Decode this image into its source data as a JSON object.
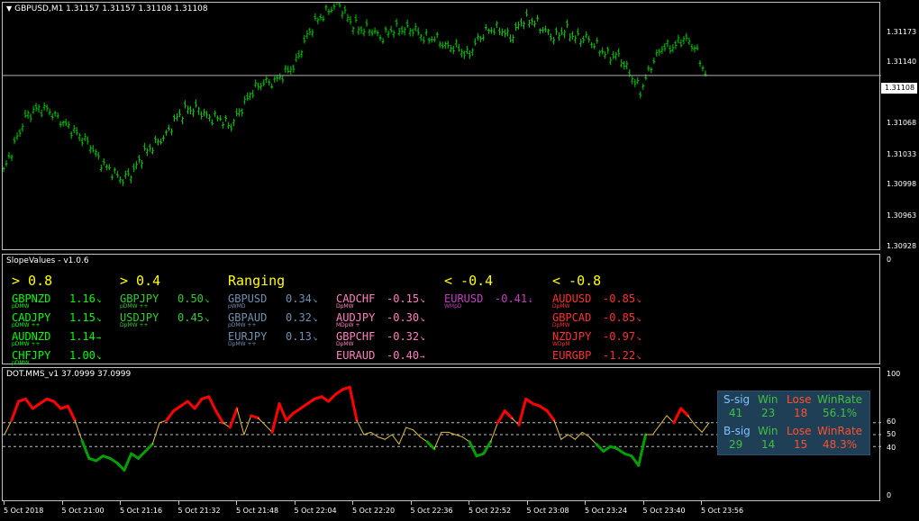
{
  "main_chart": {
    "title": "GBPUSD,M1  1.31157 1.31157 1.31108 1.31108",
    "current_price": "1.31108",
    "y_labels": [
      "1.31173",
      "1.31140",
      "1.31068",
      "1.31033",
      "1.30998",
      "1.30963",
      "1.30928"
    ],
    "bar_color": "#00c800",
    "chart_data": {
      "type": "candlestick",
      "ylim": [
        1.3091,
        1.3119
      ],
      "close_series": [
        1.31,
        1.3103,
        1.3106,
        1.3107,
        1.3107,
        1.3106,
        1.3105,
        1.3104,
        1.3103,
        1.3101,
        1.31,
        1.3099,
        1.31,
        1.3102,
        1.3103,
        1.3104,
        1.3106,
        1.3107,
        1.3107,
        1.3106,
        1.3106,
        1.3105,
        1.3107,
        1.3109,
        1.311,
        1.311,
        1.3111,
        1.3112,
        1.3115,
        1.3117,
        1.3118,
        1.3119,
        1.3117,
        1.3116,
        1.3116,
        1.3115,
        1.3116,
        1.3116,
        1.3116,
        1.3115,
        1.3115,
        1.3114,
        1.3114,
        1.3113,
        1.3115,
        1.3116,
        1.3116,
        1.3115,
        1.3117,
        1.3117,
        1.3116,
        1.3115,
        1.3116,
        1.3115,
        1.3115,
        1.3114,
        1.3113,
        1.3113,
        1.3111,
        1.3109,
        1.3112,
        1.3114,
        1.3114,
        1.3115,
        1.3114,
        1.3111
      ]
    }
  },
  "slope_panel": {
    "title": "SlopeValues - v1.0.6",
    "scale_top": "0",
    "columns": [
      {
        "header": "> 0.8",
        "color": "#ffff00",
        "items": [
          {
            "name": "GBPNZD",
            "value": "1.16",
            "arrow": "↘",
            "sub": "pDMW",
            "color": "#00ff00"
          },
          {
            "name": "CADJPY",
            "value": "1.15",
            "arrow": "↘",
            "sub": "pDMW ++",
            "color": "#00ff00"
          },
          {
            "name": "AUDNZD",
            "value": "1.14",
            "arrow": "→",
            "sub": "pDMW ++",
            "color": "#00ff00"
          },
          {
            "name": "CHFJPY",
            "value": "1.00",
            "arrow": "↘",
            "sub": "pDMW",
            "color": "#00ff00"
          }
        ]
      },
      {
        "header": "> 0.4",
        "color": "#ffff00",
        "items": [
          {
            "name": "GBPJPY",
            "value": "0.50",
            "arrow": "↘",
            "sub": "pDMW ++",
            "color": "#32cd32"
          },
          {
            "name": "USDJPY",
            "value": "0.45",
            "arrow": "↘",
            "sub": "DpMW ++",
            "color": "#32cd32"
          }
        ]
      },
      {
        "header": "Ranging",
        "color": "#ffff00",
        "items": [
          {
            "name": "GBPUSD",
            "value": "0.34",
            "arrow": "↘",
            "sub": "pWMD",
            "color": "#7090b0"
          },
          {
            "name": "GBPAUD",
            "value": "0.32",
            "arrow": "↘",
            "sub": "pDMW ++",
            "color": "#7090b0"
          },
          {
            "name": "EURJPY",
            "value": "0.13",
            "arrow": "↘",
            "sub": "DpMW ++",
            "color": "#7090b0"
          }
        ]
      },
      {
        "header": "",
        "color": "#ffff00",
        "items": [
          {
            "name": "CADCHF",
            "value": "-0.15",
            "arrow": "↘",
            "sub": "DpMW",
            "color": "#ff80c0"
          },
          {
            "name": "AUDJPY",
            "value": "-0.30",
            "arrow": "↘",
            "sub": "MDpW +",
            "color": "#ff80c0"
          },
          {
            "name": "GBPCHF",
            "value": "-0.32",
            "arrow": "↘",
            "sub": "DpMW",
            "color": "#ff80c0"
          },
          {
            "name": "EURAUD",
            "value": "-0.40",
            "arrow": "→",
            "sub": "",
            "color": "#ff80c0"
          }
        ]
      },
      {
        "header": "< -0.4",
        "color": "#ffff00",
        "items": [
          {
            "name": "EURUSD",
            "value": "-0.41",
            "arrow": "↓",
            "sub": "WMpD",
            "color": "#c040c0"
          }
        ]
      },
      {
        "header": "< -0.8",
        "color": "#ffff00",
        "items": [
          {
            "name": "AUDUSD",
            "value": "-0.85",
            "arrow": "↘",
            "sub": "DpMW",
            "color": "#ff3030"
          },
          {
            "name": "GBPCAD",
            "value": "-0.85",
            "arrow": "↘",
            "sub": "DpMW",
            "color": "#ff3030"
          },
          {
            "name": "NZDJPY",
            "value": "-0.97",
            "arrow": "↘",
            "sub": "WDpM",
            "color": "#ff3030"
          },
          {
            "name": "EURGBP",
            "value": "-1.22",
            "arrow": "↘",
            "sub": "",
            "color": "#ff3030"
          }
        ]
      }
    ]
  },
  "dot_panel": {
    "title": "DOT.MMS_v1 37.0999 37.0999",
    "levels": [
      "100",
      "60",
      "50",
      "40",
      "0"
    ],
    "chart_data": {
      "type": "line",
      "ylim": [
        0,
        100
      ],
      "hlines": [
        60,
        50,
        40
      ],
      "values": [
        50,
        62,
        78,
        80,
        72,
        76,
        80,
        78,
        72,
        74,
        62,
        45,
        30,
        28,
        32,
        30,
        26,
        20,
        34,
        30,
        36,
        42,
        60,
        62,
        70,
        74,
        78,
        72,
        80,
        82,
        70,
        60,
        56,
        72,
        50,
        66,
        64,
        58,
        52,
        76,
        62,
        68,
        72,
        76,
        80,
        82,
        78,
        84,
        88,
        90,
        62,
        50,
        52,
        48,
        46,
        50,
        42,
        56,
        54,
        48,
        44,
        38,
        52,
        52,
        50,
        48,
        44,
        32,
        34,
        44,
        60,
        70,
        64,
        58,
        80,
        76,
        74,
        70,
        62,
        46,
        50,
        46,
        52,
        48,
        42,
        36,
        40,
        38,
        34,
        32,
        24,
        50,
        50,
        58,
        66,
        60,
        72,
        66,
        58,
        52,
        60
      ],
      "series": [
        {
          "name": "S-sig",
          "color": "#ff0000"
        },
        {
          "name": "B-sig",
          "color": "#00a000"
        },
        {
          "name": "neutral",
          "color": "#e0c040"
        }
      ]
    },
    "stats": {
      "headers": [
        "S-sig",
        "Win",
        "Lose",
        "WinRate"
      ],
      "s_row": [
        "41",
        "23",
        "18",
        "56.1%"
      ],
      "b_headers": [
        "B-sig",
        "Win",
        "Lose",
        "WinRate"
      ],
      "b_row": [
        "29",
        "14",
        "15",
        "48.3%"
      ]
    }
  },
  "time_axis": [
    "5 Oct 2018",
    "5 Oct 21:00",
    "5 Oct 21:16",
    "5 Oct 21:32",
    "5 Oct 21:48",
    "5 Oct 22:04",
    "5 Oct 22:20",
    "5 Oct 22:36",
    "5 Oct 22:52",
    "5 Oct 23:08",
    "5 Oct 23:24",
    "5 Oct 23:40",
    "5 Oct 23:56"
  ]
}
